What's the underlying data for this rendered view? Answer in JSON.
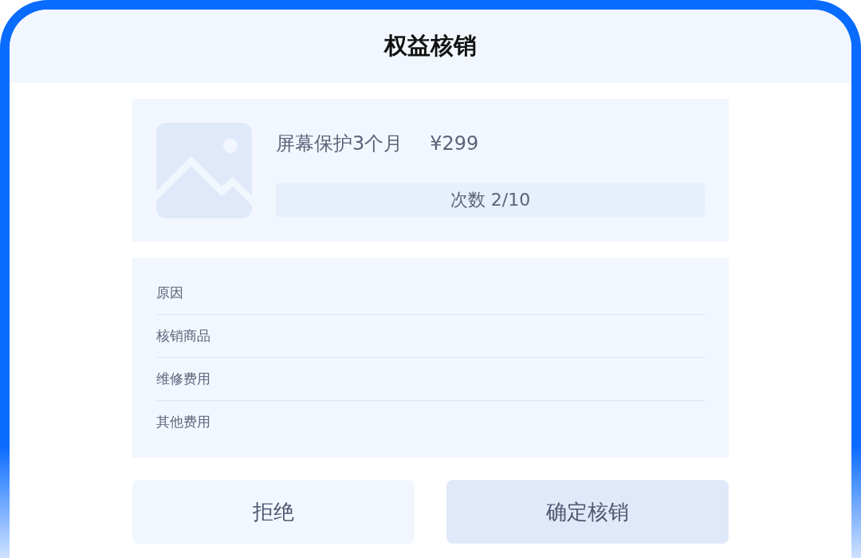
{
  "header": {
    "title": "权益核销"
  },
  "product": {
    "name": "屏幕保护3个月",
    "price": "¥299",
    "usage": "次数 2/10"
  },
  "fields": [
    {
      "label": "原因"
    },
    {
      "label": "核销商品"
    },
    {
      "label": "维修费用"
    },
    {
      "label": "其他费用"
    }
  ],
  "buttons": [
    {
      "label": "拒绝",
      "kind": "secondary"
    },
    {
      "label": "确定核销",
      "kind": "primary"
    }
  ]
}
